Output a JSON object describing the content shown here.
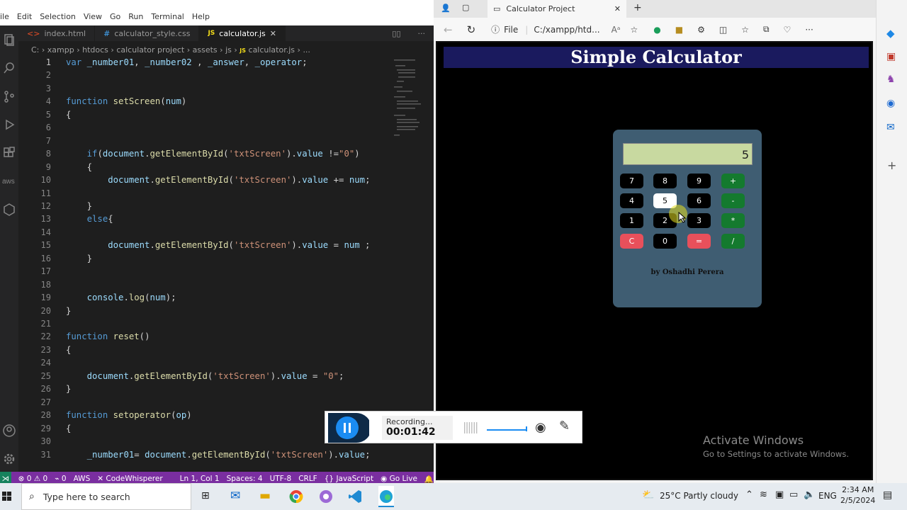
{
  "vscode": {
    "menu": [
      "ile",
      "Edit",
      "Selection",
      "View",
      "Go",
      "Run",
      "Terminal",
      "Help"
    ],
    "tabs": [
      {
        "label": "index.html",
        "icon": "html-icon"
      },
      {
        "label": "calculator_style.css",
        "icon": "css-icon"
      },
      {
        "label": "calculator.js",
        "icon": "js-icon",
        "active": true
      }
    ],
    "js_badge": "JS",
    "close_glyph": "✕",
    "breadcrumb": [
      "C:",
      "xampp",
      "htdocs",
      "calculator project",
      "assets",
      "js",
      "calculator.js",
      "..."
    ],
    "code_lines": [
      "var _number01, _number02 , _answer, _operator;",
      "",
      "",
      "function setScreen(num)",
      "{",
      "",
      "",
      "    if(document.getElementById('txtScreen').value !=\"0\")",
      "    {",
      "        document.getElementById('txtScreen').value += num;",
      "",
      "    }",
      "    else{",
      "",
      "        document.getElementById('txtScreen').value = num ;",
      "    }",
      "",
      "",
      "    console.log(num);",
      "}",
      "",
      "function reset()",
      "{",
      "",
      "    document.getElementById('txtScreen').value = \"0\";",
      "}",
      "",
      "function setoperator(op)",
      "{",
      "",
      "    _number01= document.getElementById('txtScreen').value;"
    ],
    "status": {
      "errors": "0",
      "warnings": "0",
      "ports": "0",
      "aws": "AWS",
      "codewhisperer": "CodeWhisperer",
      "position": "Ln 1, Col 1",
      "spaces": "Spaces: 4",
      "encoding": "UTF-8",
      "eol": "CRLF",
      "language": "JavaScript",
      "golive": "Go Live"
    }
  },
  "browser": {
    "tab_title": "Calculator Project",
    "add_tab": "+",
    "close_glyph": "✕",
    "file_label": "File",
    "address": "C:/xampp/htd...",
    "app_title": "Simple Calculator",
    "screen_value": "5",
    "keys": [
      "7",
      "8",
      "9",
      "+",
      "4",
      "5",
      "6",
      "-",
      "1",
      "2",
      "3",
      "*",
      "C",
      "0",
      "=",
      "/"
    ],
    "author": "by Oshadhi Perera",
    "activate_title": "Activate Windows",
    "activate_sub": "Go to Settings to activate Windows."
  },
  "recording": {
    "label": "Recording...",
    "time": "00:01:42"
  },
  "taskbar": {
    "search_placeholder": "Type here to search",
    "weather": "25°C  Partly cloudy",
    "lang": "ENG",
    "time": "2:34 AM",
    "date": "2/5/2024"
  }
}
